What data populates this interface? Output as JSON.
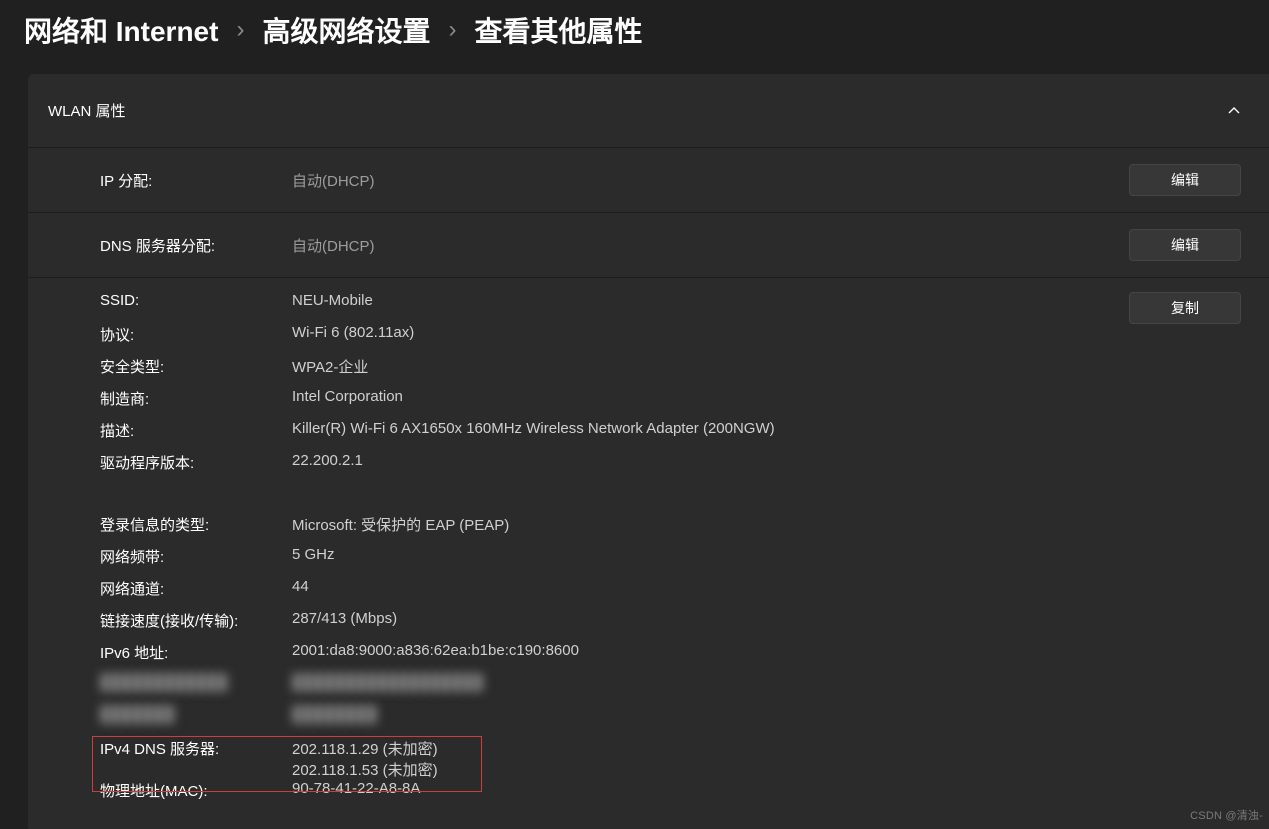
{
  "breadcrumb": {
    "a": "网络和 Internet",
    "b": "高级网络设置",
    "c": "查看其他属性"
  },
  "panel": {
    "title": "WLAN 属性"
  },
  "editRows": {
    "ip": {
      "label": "IP 分配:",
      "value": "自动(DHCP)",
      "btn": "编辑"
    },
    "dns": {
      "label": "DNS 服务器分配:",
      "value": "自动(DHCP)",
      "btn": "编辑"
    }
  },
  "copyBtn": "复制",
  "group1": {
    "ssid": {
      "l": "SSID:",
      "v": "NEU-Mobile"
    },
    "proto": {
      "l": "协议:",
      "v": "Wi-Fi 6 (802.11ax)"
    },
    "sec": {
      "l": "安全类型:",
      "v": "WPA2-企业"
    },
    "mfr": {
      "l": "制造商:",
      "v": "Intel Corporation"
    },
    "desc": {
      "l": "描述:",
      "v": "Killer(R) Wi-Fi 6 AX1650x 160MHz Wireless Network Adapter (200NGW)"
    },
    "drv": {
      "l": "驱动程序版本:",
      "v": "22.200.2.1"
    }
  },
  "group2": {
    "login": {
      "l": "登录信息的类型:",
      "v": "Microsoft: 受保护的 EAP (PEAP)"
    },
    "band": {
      "l": "网络频带:",
      "v": "5 GHz"
    },
    "chan": {
      "l": "网络通道:",
      "v": "44"
    },
    "link": {
      "l": "链接速度(接收/传输):",
      "v": "287/413 (Mbps)"
    },
    "ipv6": {
      "l": "IPv6 地址:",
      "v": "2001:da8:9000:a836:62ea:b1be:c190:8600"
    },
    "red1": {
      "l": "████████████",
      "v": "██████████████████"
    },
    "red2": {
      "l": "███████",
      "v": "████████"
    },
    "dns4": {
      "l": "IPv4 DNS 服务器:",
      "v": "202.118.1.29 (未加密)\n202.118.1.53 (未加密)"
    },
    "mac": {
      "l": "物理地址(MAC):",
      "v": "90-78-41-22-A8-8A"
    }
  },
  "watermark": "CSDN @清浊-"
}
